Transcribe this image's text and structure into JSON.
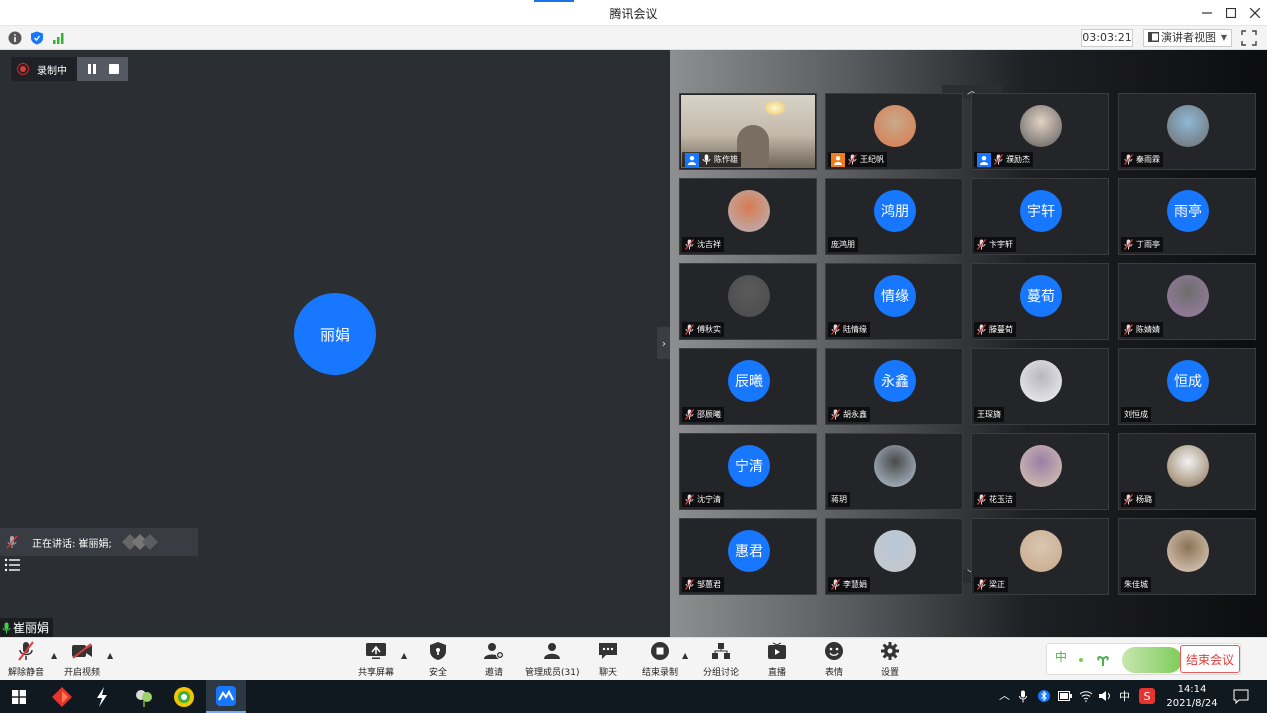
{
  "window": {
    "title": "腾讯会议"
  },
  "infobar": {
    "timer": "03:03:21",
    "view_label": "演讲者视图"
  },
  "recording": {
    "label": "录制中"
  },
  "main": {
    "speaker_avatar": "丽娟",
    "speaking_text": "正在讲话: 崔丽娟;",
    "self_name": "崔丽娟"
  },
  "gallery": {
    "tiles": [
      {
        "name": "陈作雄",
        "avatar": "",
        "kind": "video",
        "badge": "blue",
        "mic": "on"
      },
      {
        "name": "王纪帆",
        "avatar": "",
        "kind": "image",
        "badge": "orange",
        "mic": "muted"
      },
      {
        "name": "濮励杰",
        "avatar": "",
        "kind": "image",
        "badge": "blue",
        "mic": "muted"
      },
      {
        "name": "秦雨霖",
        "avatar": "",
        "kind": "image",
        "badge": "",
        "mic": "muted"
      },
      {
        "name": "沈吉祥",
        "avatar": "",
        "kind": "image",
        "badge": "",
        "mic": "muted"
      },
      {
        "name": "庞鸿朋",
        "avatar": "鸿朋",
        "kind": "text",
        "badge": "",
        "mic": ""
      },
      {
        "name": "卞宇轩",
        "avatar": "宇轩",
        "kind": "text",
        "badge": "",
        "mic": "muted"
      },
      {
        "name": "丁雨亭",
        "avatar": "雨亭",
        "kind": "text",
        "badge": "",
        "mic": "muted"
      },
      {
        "name": "傅秋实",
        "avatar": "",
        "kind": "image",
        "badge": "",
        "mic": "muted"
      },
      {
        "name": "陆情缘",
        "avatar": "情缘",
        "kind": "text",
        "badge": "",
        "mic": "muted"
      },
      {
        "name": "滕蔓荀",
        "avatar": "蔓荀",
        "kind": "text",
        "badge": "",
        "mic": "muted"
      },
      {
        "name": "陈婧婧",
        "avatar": "",
        "kind": "image",
        "badge": "",
        "mic": "muted"
      },
      {
        "name": "邵辰曦",
        "avatar": "辰曦",
        "kind": "text",
        "badge": "",
        "mic": "muted"
      },
      {
        "name": "胡永鑫",
        "avatar": "永鑫",
        "kind": "text",
        "badge": "",
        "mic": "muted"
      },
      {
        "name": "王琛旖",
        "avatar": "",
        "kind": "image",
        "badge": "",
        "mic": ""
      },
      {
        "name": "刘恒成",
        "avatar": "恒成",
        "kind": "text",
        "badge": "",
        "mic": ""
      },
      {
        "name": "沈宁清",
        "avatar": "宁清",
        "kind": "text",
        "badge": "",
        "mic": "muted"
      },
      {
        "name": "蒋玥",
        "avatar": "",
        "kind": "image",
        "badge": "",
        "mic": ""
      },
      {
        "name": "花玉洁",
        "avatar": "",
        "kind": "image",
        "badge": "",
        "mic": "muted"
      },
      {
        "name": "杨璐",
        "avatar": "",
        "kind": "image",
        "badge": "",
        "mic": "muted"
      },
      {
        "name": "邹蕙君",
        "avatar": "惠君",
        "kind": "text",
        "badge": "",
        "mic": "muted"
      },
      {
        "name": "李慧娟",
        "avatar": "",
        "kind": "image",
        "badge": "",
        "mic": "muted"
      },
      {
        "name": "梁正",
        "avatar": "",
        "kind": "image",
        "badge": "",
        "mic": "muted"
      },
      {
        "name": "朱佳城",
        "avatar": "",
        "kind": "image",
        "badge": "",
        "mic": ""
      }
    ]
  },
  "toolbar": {
    "unmute": "解除静音",
    "video": "开启视频",
    "share": "共享屏幕",
    "security": "安全",
    "invite": "邀请",
    "members": "管理成员(31)",
    "chat": "聊天",
    "end_record": "结束录制",
    "breakout": "分组讨论",
    "live": "直播",
    "emoji": "表情",
    "settings": "设置",
    "end_deco": "中",
    "end_meeting": "结束会议"
  },
  "taskbar": {
    "ime": "中",
    "time": "14:14",
    "date": "2021/8/24"
  },
  "colors": {
    "accent": "#1777ff",
    "record": "#e03a3a",
    "end": "#e03a3a"
  }
}
